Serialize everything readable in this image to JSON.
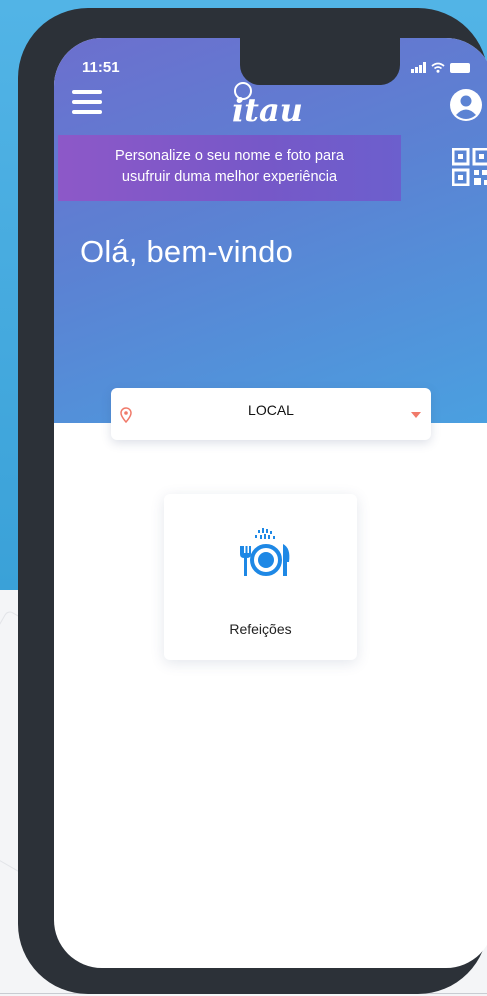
{
  "status_bar": {
    "time": "11:51"
  },
  "header": {
    "logo_text": "itau"
  },
  "banner": {
    "line1": "Personalize o seu nome e foto para",
    "line2": "usufruir duma melhor experiência"
  },
  "welcome": "Olá, bem-vindo",
  "location": {
    "label": "LOCAL"
  },
  "cards": [
    {
      "label": "Refeições",
      "icon": "meal-icon"
    }
  ],
  "colors": {
    "header_gradient_start": "#6c6fce",
    "header_gradient_end": "#4aa0e0",
    "banner": "#8058c8",
    "background": "#3aa1d8",
    "accent": "#f07a6a",
    "icon_blue": "#1e88e5"
  }
}
